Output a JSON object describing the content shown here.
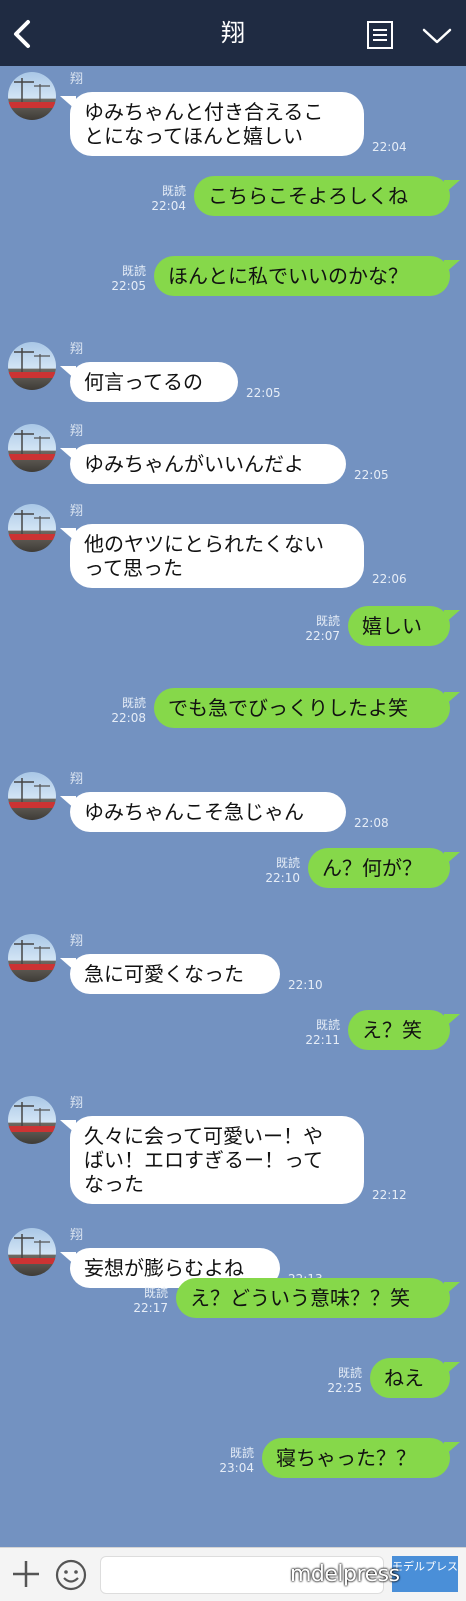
{
  "header": {
    "title": "翔",
    "back_icon": "chevron-left-icon",
    "menu_icon": "notes-icon",
    "more_icon": "chevron-down-icon"
  },
  "colors": {
    "background": "#7392c1",
    "header": "#1f2b42",
    "incoming_bubble": "#ffffff",
    "outgoing_bubble": "#86d84a"
  },
  "contact": {
    "name": "翔"
  },
  "messages": [
    {
      "dir": "in",
      "lines": [
        "ゆみちゃんと付き合えるこ",
        "とになってほんと嬉しい"
      ],
      "time": "22:04"
    },
    {
      "dir": "out",
      "text": "こちらこそよろしくね",
      "read": "既読",
      "time": "22:04"
    },
    {
      "dir": "out",
      "text": "ほんとに私でいいのかな？",
      "read": "既読",
      "time": "22:05"
    },
    {
      "dir": "in",
      "text": "何言ってるの",
      "time": "22:05"
    },
    {
      "dir": "in",
      "text": "ゆみちゃんがいいんだよ",
      "time": "22:05"
    },
    {
      "dir": "in",
      "lines": [
        "他のヤツにとられたくない",
        "って思った"
      ],
      "time": "22:06"
    },
    {
      "dir": "out",
      "text": "嬉しい",
      "read": "既読",
      "time": "22:07"
    },
    {
      "dir": "out",
      "text": "でも急でびっくりしたよ笑",
      "read": "既読",
      "time": "22:08"
    },
    {
      "dir": "in",
      "text": "ゆみちゃんこそ急じゃん",
      "time": "22:08"
    },
    {
      "dir": "out",
      "text": "ん？何が？",
      "read": "既読",
      "time": "22:10"
    },
    {
      "dir": "in",
      "text": "急に可愛くなった",
      "time": "22:10"
    },
    {
      "dir": "out",
      "text": "え？笑",
      "read": "既読",
      "time": "22:11"
    },
    {
      "dir": "in",
      "lines": [
        "久々に会って可愛いー！や",
        "ばい！エロすぎるー！って",
        "なった"
      ],
      "time": "22:12"
    },
    {
      "dir": "in",
      "text": "妄想が膨らむよね",
      "time": "22:13"
    },
    {
      "dir": "out",
      "text": "え？どういう意味？？笑",
      "read": "既読",
      "time": "22:17"
    },
    {
      "dir": "out",
      "text": "ねえ",
      "read": "既読",
      "time": "22:25"
    },
    {
      "dir": "out",
      "text": "寝ちゃった？？",
      "read": "既読",
      "time": "23:04"
    }
  ],
  "input": {
    "plus_icon": "plus-icon",
    "emoji_icon": "smiley-icon",
    "send_label": "モデルプレス"
  },
  "watermark": "mdelpress"
}
